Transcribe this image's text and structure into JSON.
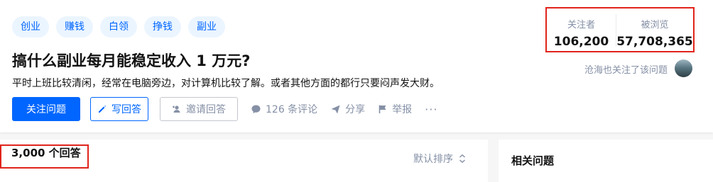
{
  "topics": [
    "创业",
    "赚钱",
    "白领",
    "挣钱",
    "副业"
  ],
  "question": {
    "title": "搞什么副业每月能稳定收入 1 万元?",
    "detail": "平时上班比较清闲，经常在电脑旁边，对计算机比较了解。或者其他方面的都行只要闷声发大财。"
  },
  "actions": {
    "follow": "关注问题",
    "write": "写回答",
    "invite": "邀请回答",
    "comments": "126 条评论",
    "share": "分享",
    "report": "举报",
    "more": "···"
  },
  "stats": {
    "followers_label": "关注者",
    "followers_value": "106,200",
    "views_label": "被浏览",
    "views_value": "57,708,365"
  },
  "followed_note": "沧海也关注了该问题",
  "answers": {
    "count_label": "3,000 个回答",
    "sort_label": "默认排序"
  },
  "related": {
    "title": "相关问题"
  },
  "colors": {
    "brand_blue": "#0066ff",
    "tag_bg": "#ebf5ff",
    "highlight_red": "#e0241b",
    "muted_grey": "#8590a6"
  },
  "icons": [
    "pencil-icon",
    "invite-user-icon",
    "comment-icon",
    "share-icon",
    "flag-icon",
    "sort-icon"
  ]
}
